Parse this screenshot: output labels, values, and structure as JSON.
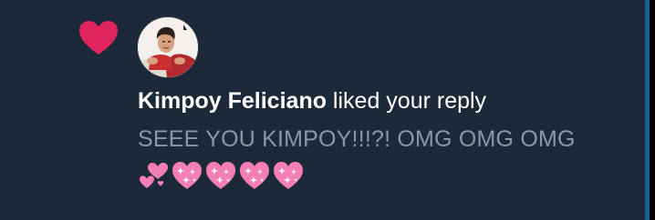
{
  "notification": {
    "icon": "heart-icon",
    "actor_name": "Kimpoy Feliciano",
    "action_text": " liked your reply",
    "reply_text": "SEEE YOU KIMPOY!!!?! OMG OMG OMG",
    "emojis": [
      "two-hearts-icon",
      "sparkling-heart-icon",
      "sparkling-heart-icon",
      "sparkling-heart-icon",
      "sparkling-heart-icon"
    ]
  },
  "colors": {
    "background": "#1c2938",
    "heart": "#e0245e",
    "primary_text": "#ffffff",
    "secondary_text": "#8899a6",
    "accent_strip": "#1b5f99",
    "emoji_pink": "#f47fb5"
  }
}
